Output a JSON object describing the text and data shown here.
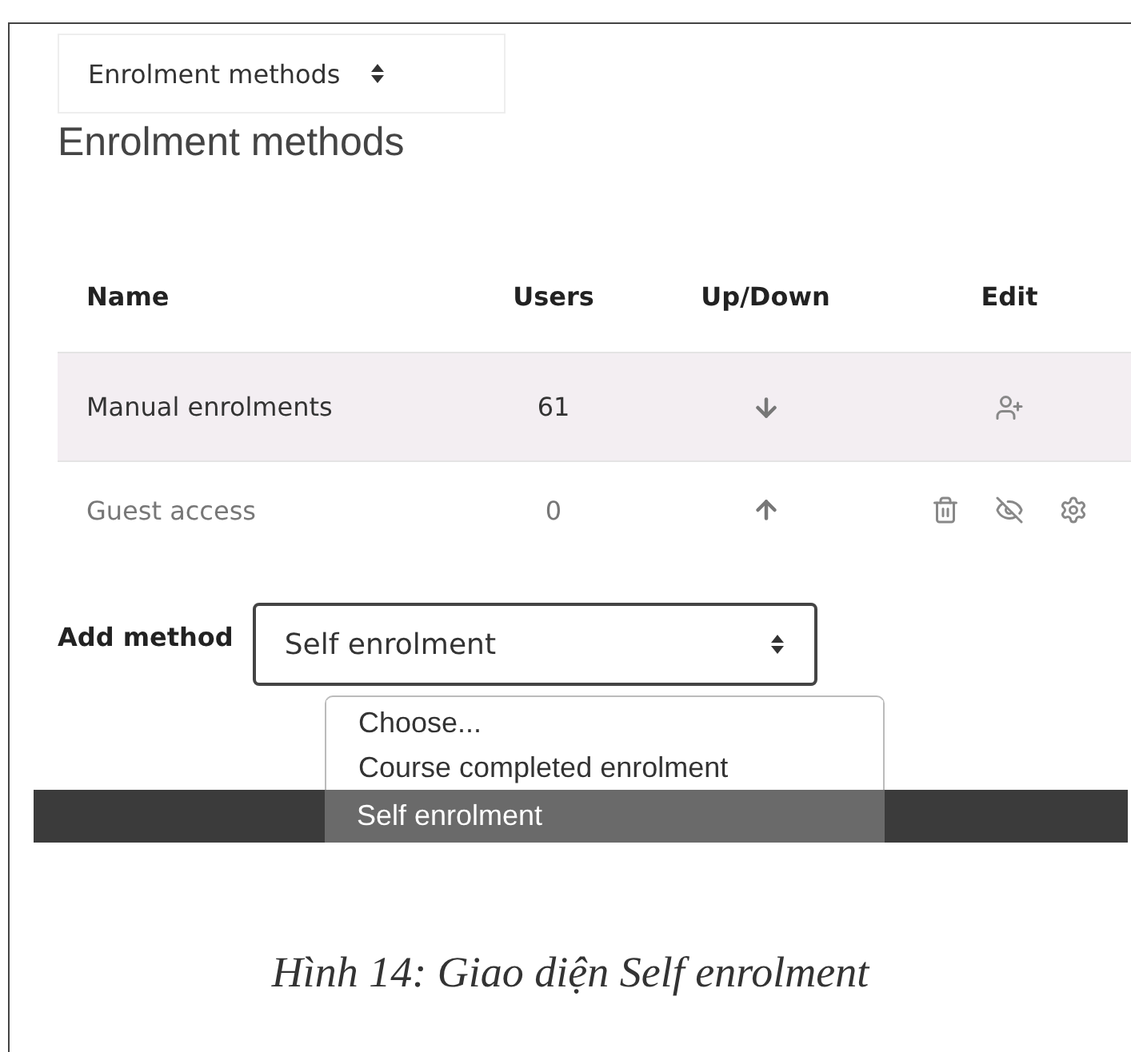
{
  "page_select": {
    "value": "Enrolment methods"
  },
  "heading": "Enrolment methods",
  "table": {
    "columns": [
      "Name",
      "Users",
      "Up/Down",
      "Edit"
    ],
    "rows": [
      {
        "name": "Manual enrolments",
        "users": "61",
        "move": {
          "kind": "down"
        },
        "highlighted": true,
        "disabled": false,
        "actions": [
          {
            "kind": "enrol"
          }
        ]
      },
      {
        "name": "Guest access",
        "users": "0",
        "move": {
          "kind": "up"
        },
        "highlighted": false,
        "disabled": true,
        "actions": [
          {
            "kind": "delete"
          },
          {
            "kind": "hide"
          },
          {
            "kind": "settings"
          }
        ]
      }
    ]
  },
  "add_method": {
    "label": "Add method",
    "value": "Self enrolment",
    "options": [
      {
        "label": "Choose...",
        "selected": false
      },
      {
        "label": "Course completed enrolment",
        "selected": false
      },
      {
        "label": "Self enrolment",
        "selected": true
      }
    ]
  },
  "caption": "Hình 14: Giao diện Self enrolment"
}
